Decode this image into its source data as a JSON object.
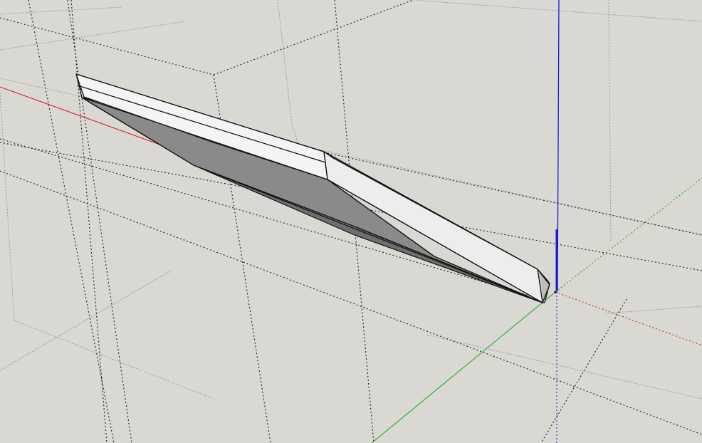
{
  "viewport": {
    "background": "#d9d8d3"
  },
  "colors": {
    "axis_red": "#d11a1a",
    "axis_green": "#17a817",
    "axis_blue": "#1a1ad1",
    "face_light": "#ededed",
    "face_top": "#f4f4f4",
    "face_shadow": "#8a8a8a",
    "face_dark": "#6e6e6e",
    "edge": "#101010",
    "guide": "#1a1a1a",
    "guide_light": "#9a9a9a"
  },
  "icons": {
    "model_origin": "axes-origin-icon"
  }
}
